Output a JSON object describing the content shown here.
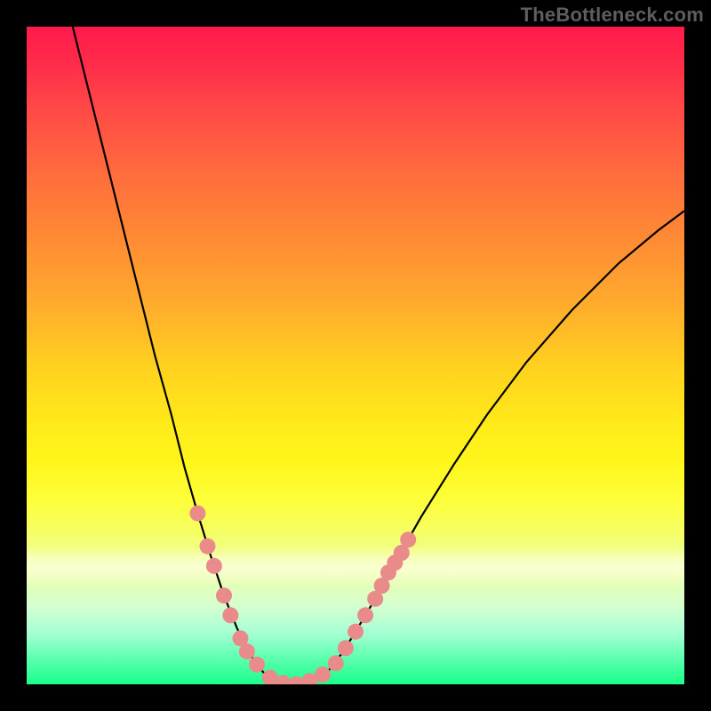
{
  "watermark": "TheBottleneck.com",
  "colors": {
    "dot": "#e98b8b",
    "curve": "#000000",
    "frame": "#000000"
  },
  "chart_data": {
    "type": "line",
    "title": "",
    "xlabel": "",
    "ylabel": "",
    "xlim": [
      0,
      100
    ],
    "ylim": [
      0,
      100
    ],
    "background": "heat-gradient",
    "curve_points": [
      {
        "x": 7.0,
        "y": 100.0
      },
      {
        "x": 9.5,
        "y": 90.0
      },
      {
        "x": 12.0,
        "y": 80.0
      },
      {
        "x": 14.5,
        "y": 70.0
      },
      {
        "x": 17.0,
        "y": 60.0
      },
      {
        "x": 19.5,
        "y": 50.0
      },
      {
        "x": 22.0,
        "y": 41.0
      },
      {
        "x": 24.0,
        "y": 33.0
      },
      {
        "x": 26.0,
        "y": 26.0
      },
      {
        "x": 28.0,
        "y": 19.5
      },
      {
        "x": 30.0,
        "y": 13.5
      },
      {
        "x": 32.0,
        "y": 8.5
      },
      {
        "x": 34.0,
        "y": 4.5
      },
      {
        "x": 36.0,
        "y": 1.8
      },
      {
        "x": 38.0,
        "y": 0.5
      },
      {
        "x": 40.0,
        "y": 0.0
      },
      {
        "x": 42.0,
        "y": 0.1
      },
      {
        "x": 44.0,
        "y": 0.8
      },
      {
        "x": 46.0,
        "y": 2.2
      },
      {
        "x": 48.0,
        "y": 4.8
      },
      {
        "x": 50.0,
        "y": 8.0
      },
      {
        "x": 53.0,
        "y": 13.0
      },
      {
        "x": 56.0,
        "y": 18.5
      },
      {
        "x": 60.0,
        "y": 25.5
      },
      {
        "x": 65.0,
        "y": 33.5
      },
      {
        "x": 70.0,
        "y": 41.0
      },
      {
        "x": 76.0,
        "y": 49.0
      },
      {
        "x": 83.0,
        "y": 57.0
      },
      {
        "x": 90.0,
        "y": 64.0
      },
      {
        "x": 96.0,
        "y": 69.0
      },
      {
        "x": 100.0,
        "y": 72.0
      }
    ],
    "dot_points": [
      {
        "x": 26.0,
        "y": 26.0
      },
      {
        "x": 27.5,
        "y": 21.0
      },
      {
        "x": 28.5,
        "y": 18.0
      },
      {
        "x": 30.0,
        "y": 13.5
      },
      {
        "x": 31.0,
        "y": 10.5
      },
      {
        "x": 32.5,
        "y": 7.0
      },
      {
        "x": 33.5,
        "y": 5.0
      },
      {
        "x": 35.0,
        "y": 3.0
      },
      {
        "x": 37.0,
        "y": 1.0
      },
      {
        "x": 39.0,
        "y": 0.2
      },
      {
        "x": 41.0,
        "y": 0.0
      },
      {
        "x": 43.0,
        "y": 0.5
      },
      {
        "x": 45.0,
        "y": 1.5
      },
      {
        "x": 47.0,
        "y": 3.2
      },
      {
        "x": 48.5,
        "y": 5.5
      },
      {
        "x": 50.0,
        "y": 8.0
      },
      {
        "x": 51.5,
        "y": 10.5
      },
      {
        "x": 53.0,
        "y": 13.0
      },
      {
        "x": 54.0,
        "y": 15.0
      },
      {
        "x": 55.0,
        "y": 17.0
      },
      {
        "x": 56.0,
        "y": 18.5
      },
      {
        "x": 57.0,
        "y": 20.0
      },
      {
        "x": 58.0,
        "y": 22.0
      }
    ],
    "dot_radius_px": 9
  }
}
